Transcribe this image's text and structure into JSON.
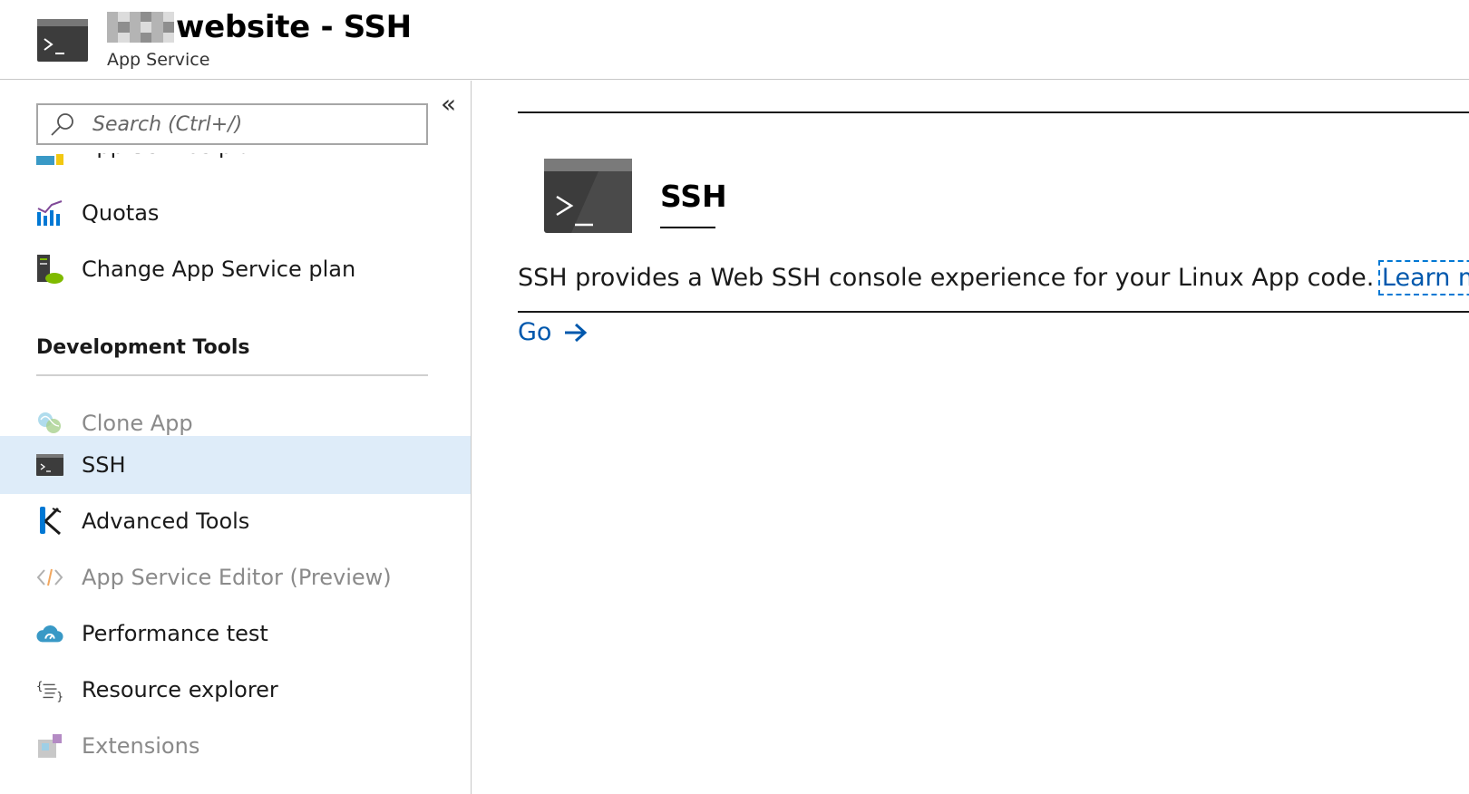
{
  "header": {
    "title": "website - SSH",
    "subtitle": "App Service"
  },
  "sidebar": {
    "search_placeholder": "Search (Ctrl+/)",
    "collapse_label": "«",
    "partial_item_label": "App Service plan",
    "items_top": [
      {
        "label": "Quotas",
        "icon": "quotas-chart-icon"
      },
      {
        "label": "Change App Service plan",
        "icon": "change-plan-icon"
      }
    ],
    "section_title": "Development Tools",
    "dev_items": [
      {
        "label": "Clone App",
        "icon": "clone-app-icon",
        "disabled": true
      },
      {
        "label": "SSH",
        "icon": "ssh-terminal-icon",
        "selected": true
      },
      {
        "label": "Advanced Tools",
        "icon": "kudu-icon"
      },
      {
        "label": "App Service Editor (Preview)",
        "icon": "code-editor-icon",
        "disabled": true
      },
      {
        "label": "Performance test",
        "icon": "cloud-gauge-icon"
      },
      {
        "label": "Resource explorer",
        "icon": "resource-explorer-icon"
      },
      {
        "label": "Extensions",
        "icon": "extensions-icon",
        "disabled": true
      }
    ]
  },
  "main": {
    "feature_title": "SSH",
    "description": "SSH provides a Web SSH console experience for your Linux App code.",
    "learn_more_label": "Learn more",
    "go_label": "Go"
  },
  "colors": {
    "accent_link": "#0058ad",
    "selected_bg": "#deecf9",
    "terminal_dark": "#3c3c3c"
  }
}
